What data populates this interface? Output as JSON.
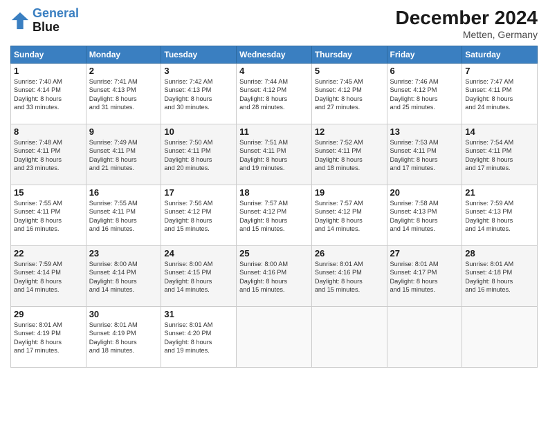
{
  "header": {
    "logo_line1": "General",
    "logo_line2": "Blue",
    "month_title": "December 2024",
    "location": "Metten, Germany"
  },
  "days_of_week": [
    "Sunday",
    "Monday",
    "Tuesday",
    "Wednesday",
    "Thursday",
    "Friday",
    "Saturday"
  ],
  "weeks": [
    [
      {
        "day": "1",
        "detail": "Sunrise: 7:40 AM\nSunset: 4:14 PM\nDaylight: 8 hours\nand 33 minutes."
      },
      {
        "day": "2",
        "detail": "Sunrise: 7:41 AM\nSunset: 4:13 PM\nDaylight: 8 hours\nand 31 minutes."
      },
      {
        "day": "3",
        "detail": "Sunrise: 7:42 AM\nSunset: 4:13 PM\nDaylight: 8 hours\nand 30 minutes."
      },
      {
        "day": "4",
        "detail": "Sunrise: 7:44 AM\nSunset: 4:12 PM\nDaylight: 8 hours\nand 28 minutes."
      },
      {
        "day": "5",
        "detail": "Sunrise: 7:45 AM\nSunset: 4:12 PM\nDaylight: 8 hours\nand 27 minutes."
      },
      {
        "day": "6",
        "detail": "Sunrise: 7:46 AM\nSunset: 4:12 PM\nDaylight: 8 hours\nand 25 minutes."
      },
      {
        "day": "7",
        "detail": "Sunrise: 7:47 AM\nSunset: 4:11 PM\nDaylight: 8 hours\nand 24 minutes."
      }
    ],
    [
      {
        "day": "8",
        "detail": "Sunrise: 7:48 AM\nSunset: 4:11 PM\nDaylight: 8 hours\nand 23 minutes."
      },
      {
        "day": "9",
        "detail": "Sunrise: 7:49 AM\nSunset: 4:11 PM\nDaylight: 8 hours\nand 21 minutes."
      },
      {
        "day": "10",
        "detail": "Sunrise: 7:50 AM\nSunset: 4:11 PM\nDaylight: 8 hours\nand 20 minutes."
      },
      {
        "day": "11",
        "detail": "Sunrise: 7:51 AM\nSunset: 4:11 PM\nDaylight: 8 hours\nand 19 minutes."
      },
      {
        "day": "12",
        "detail": "Sunrise: 7:52 AM\nSunset: 4:11 PM\nDaylight: 8 hours\nand 18 minutes."
      },
      {
        "day": "13",
        "detail": "Sunrise: 7:53 AM\nSunset: 4:11 PM\nDaylight: 8 hours\nand 17 minutes."
      },
      {
        "day": "14",
        "detail": "Sunrise: 7:54 AM\nSunset: 4:11 PM\nDaylight: 8 hours\nand 17 minutes."
      }
    ],
    [
      {
        "day": "15",
        "detail": "Sunrise: 7:55 AM\nSunset: 4:11 PM\nDaylight: 8 hours\nand 16 minutes."
      },
      {
        "day": "16",
        "detail": "Sunrise: 7:55 AM\nSunset: 4:11 PM\nDaylight: 8 hours\nand 16 minutes."
      },
      {
        "day": "17",
        "detail": "Sunrise: 7:56 AM\nSunset: 4:12 PM\nDaylight: 8 hours\nand 15 minutes."
      },
      {
        "day": "18",
        "detail": "Sunrise: 7:57 AM\nSunset: 4:12 PM\nDaylight: 8 hours\nand 15 minutes."
      },
      {
        "day": "19",
        "detail": "Sunrise: 7:57 AM\nSunset: 4:12 PM\nDaylight: 8 hours\nand 14 minutes."
      },
      {
        "day": "20",
        "detail": "Sunrise: 7:58 AM\nSunset: 4:13 PM\nDaylight: 8 hours\nand 14 minutes."
      },
      {
        "day": "21",
        "detail": "Sunrise: 7:59 AM\nSunset: 4:13 PM\nDaylight: 8 hours\nand 14 minutes."
      }
    ],
    [
      {
        "day": "22",
        "detail": "Sunrise: 7:59 AM\nSunset: 4:14 PM\nDaylight: 8 hours\nand 14 minutes."
      },
      {
        "day": "23",
        "detail": "Sunrise: 8:00 AM\nSunset: 4:14 PM\nDaylight: 8 hours\nand 14 minutes."
      },
      {
        "day": "24",
        "detail": "Sunrise: 8:00 AM\nSunset: 4:15 PM\nDaylight: 8 hours\nand 14 minutes."
      },
      {
        "day": "25",
        "detail": "Sunrise: 8:00 AM\nSunset: 4:16 PM\nDaylight: 8 hours\nand 15 minutes."
      },
      {
        "day": "26",
        "detail": "Sunrise: 8:01 AM\nSunset: 4:16 PM\nDaylight: 8 hours\nand 15 minutes."
      },
      {
        "day": "27",
        "detail": "Sunrise: 8:01 AM\nSunset: 4:17 PM\nDaylight: 8 hours\nand 15 minutes."
      },
      {
        "day": "28",
        "detail": "Sunrise: 8:01 AM\nSunset: 4:18 PM\nDaylight: 8 hours\nand 16 minutes."
      }
    ],
    [
      {
        "day": "29",
        "detail": "Sunrise: 8:01 AM\nSunset: 4:19 PM\nDaylight: 8 hours\nand 17 minutes."
      },
      {
        "day": "30",
        "detail": "Sunrise: 8:01 AM\nSunset: 4:19 PM\nDaylight: 8 hours\nand 18 minutes."
      },
      {
        "day": "31",
        "detail": "Sunrise: 8:01 AM\nSunset: 4:20 PM\nDaylight: 8 hours\nand 19 minutes."
      },
      null,
      null,
      null,
      null
    ]
  ]
}
